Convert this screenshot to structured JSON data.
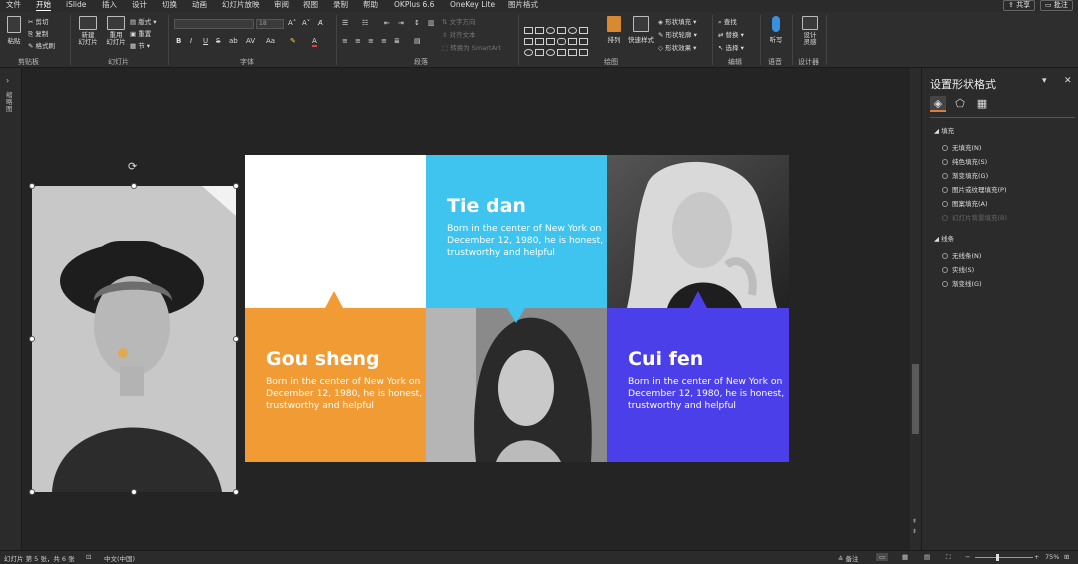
{
  "menu": {
    "tabs": [
      "文件",
      "开始",
      "iSlide",
      "插入",
      "设计",
      "切换",
      "动画",
      "幻灯片放映",
      "审阅",
      "视图",
      "录制",
      "帮助",
      "OKPlus 6.6",
      "OneKey Lite",
      "图片格式"
    ],
    "active": "开始",
    "share": "共享",
    "comment": "批注"
  },
  "ribbon": {
    "clipboard": {
      "paste": "粘贴",
      "cut": "剪切",
      "copy": "复制",
      "format_painter": "格式刷",
      "label": "剪贴板"
    },
    "slides": {
      "new_slide": "新建\n幻灯片",
      "reuse_slide": "重用\n幻灯片",
      "layout": "版式",
      "reset": "重置",
      "section": "节",
      "label": "幻灯片"
    },
    "font": {
      "label": "字体",
      "size": "18",
      "glyphs": [
        "B",
        "I",
        "U",
        "S",
        "ab",
        "AV",
        "Aa",
        "A"
      ]
    },
    "paragraph": {
      "text_direction": "文字方向",
      "align_text": "对齐文本",
      "smartart": "转换为 SmartArt",
      "label": "段落"
    },
    "drawing": {
      "arrange": "排列",
      "quick_styles": "快速样式",
      "shape_fill": "形状填充",
      "shape_outline": "形状轮廓",
      "shape_effects": "形状效果",
      "label": "绘图"
    },
    "editing": {
      "find": "查找",
      "replace": "替换",
      "select": "选择",
      "label": "编辑"
    },
    "voice": {
      "dictate": "听写",
      "label": "语音"
    },
    "designer": {
      "design_ideas": "设计\n灵感",
      "label": "设计器"
    }
  },
  "left_strip": {
    "label": "缩略图"
  },
  "slide": {
    "cards": [
      {
        "name": "Tie dan",
        "desc": "Born in the center of New York on December 12, 1980, he is honest, trustworthy and helpful"
      },
      {
        "name": "Gou sheng",
        "desc": "Born in the center of New York on December 12, 1980, he is honest, trustworthy and helpful"
      },
      {
        "name": "Cui fen",
        "desc": "Born in the center of New York on December 12, 1980, he is honest, trustworthy and helpful"
      }
    ],
    "colors": {
      "cyan": "#3ec4ef",
      "orange": "#f19b34",
      "blue": "#4b3fea"
    }
  },
  "pane": {
    "title": "设置形状格式",
    "fill": {
      "heading": "填充",
      "options": [
        "无填充(N)",
        "纯色填充(S)",
        "渐变填充(G)",
        "图片或纹理填充(P)",
        "图案填充(A)",
        "幻灯片背景填充(B)"
      ]
    },
    "line": {
      "heading": "线条",
      "options": [
        "无线条(N)",
        "实线(S)",
        "渐变线(G)"
      ]
    }
  },
  "status": {
    "slide_info": "幻灯片 第 5 张，共 6 张",
    "language": "中文(中国)",
    "notes": "备注",
    "zoom": "75%"
  }
}
